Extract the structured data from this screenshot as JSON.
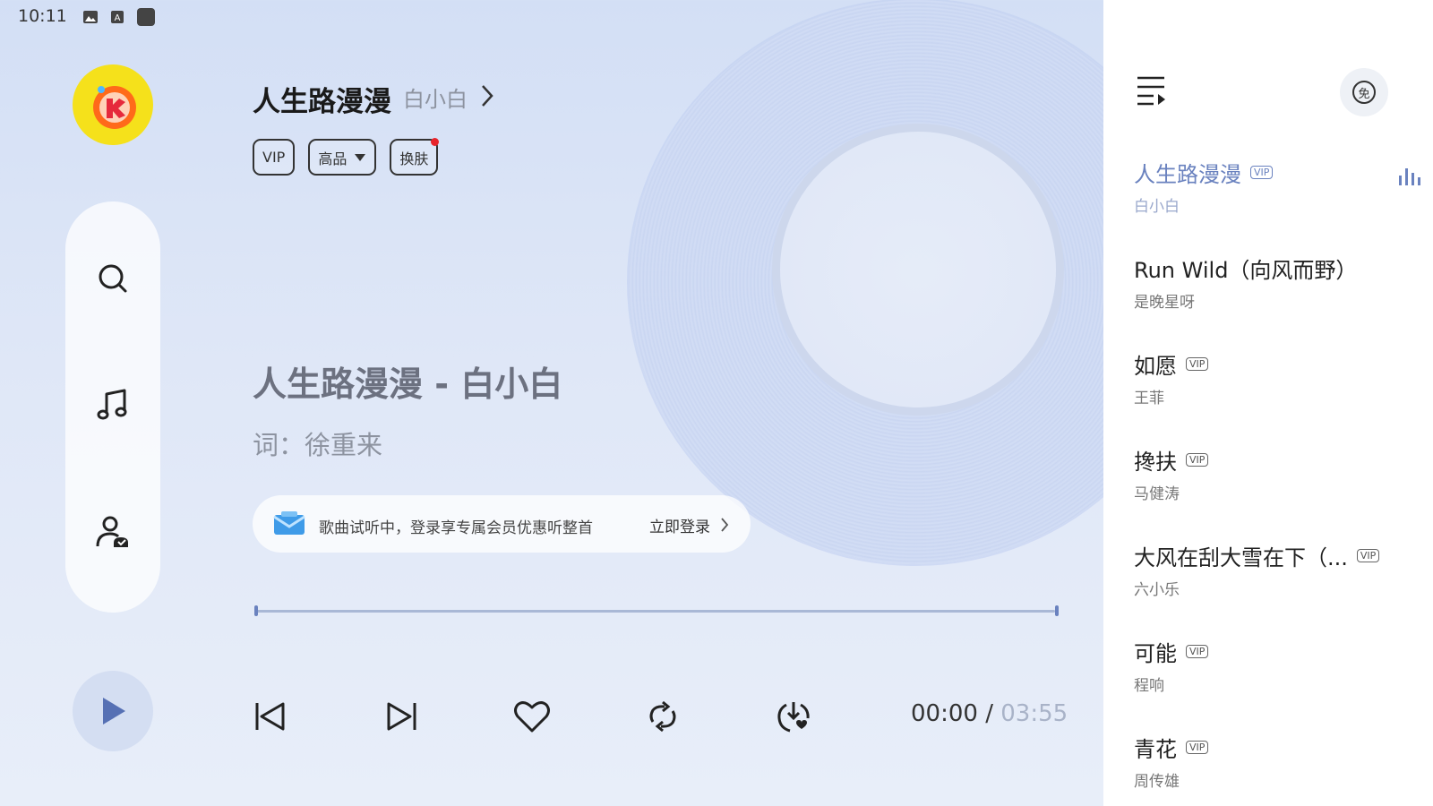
{
  "status_bar": {
    "time": "10:11",
    "icons": [
      "image-icon",
      "a-icon",
      "app-square-icon"
    ],
    "right_icons": [
      "wifi-icon",
      "signal-icon",
      "battery-icon"
    ]
  },
  "sidebar": {
    "logo": "app-logo",
    "nav": [
      {
        "name": "search-icon"
      },
      {
        "name": "music-note-icon"
      },
      {
        "name": "user-icon"
      }
    ],
    "play": "play-icon"
  },
  "header": {
    "title": "人生路漫漫",
    "artist": "白小白",
    "tags": [
      "VIP",
      "高品",
      "换肤"
    ]
  },
  "lyrics": {
    "line1": "人生路漫漫 - 白小白",
    "line2": "词：徐重来"
  },
  "banner": {
    "text": "歌曲试听中，登录享专属会员优惠听整首",
    "link": "立即登录"
  },
  "player": {
    "progress": 0,
    "current_time": "00:00",
    "separator": " / ",
    "total_time": "03:55",
    "controls": [
      "prev-icon",
      "next-icon",
      "heart-icon",
      "repeat-icon",
      "download-icon"
    ]
  },
  "colors": {
    "accent": "#6a82bf",
    "logo_yellow": "#f5e11b",
    "logo_orange": "#ff6a1a",
    "dot_red": "#e8242b"
  },
  "playlist": {
    "free_label": "免",
    "tracks": [
      {
        "title": "人生路漫漫",
        "artist": "白小白",
        "vip": "VIP",
        "active": true
      },
      {
        "title": "Run Wild（向风而野）",
        "artist": "是晚星呀",
        "vip": "",
        "active": false
      },
      {
        "title": "如愿",
        "artist": "王菲",
        "vip": "VIP",
        "active": false
      },
      {
        "title": "搀扶",
        "artist": "马健涛",
        "vip": "VIP",
        "active": false
      },
      {
        "title": "大风在刮大雪在下（...",
        "artist": "六小乐",
        "vip": "VIP",
        "active": false
      },
      {
        "title": "可能",
        "artist": "程响",
        "vip": "VIP",
        "active": false
      },
      {
        "title": "青花",
        "artist": "周传雄",
        "vip": "VIP",
        "active": false
      }
    ]
  }
}
